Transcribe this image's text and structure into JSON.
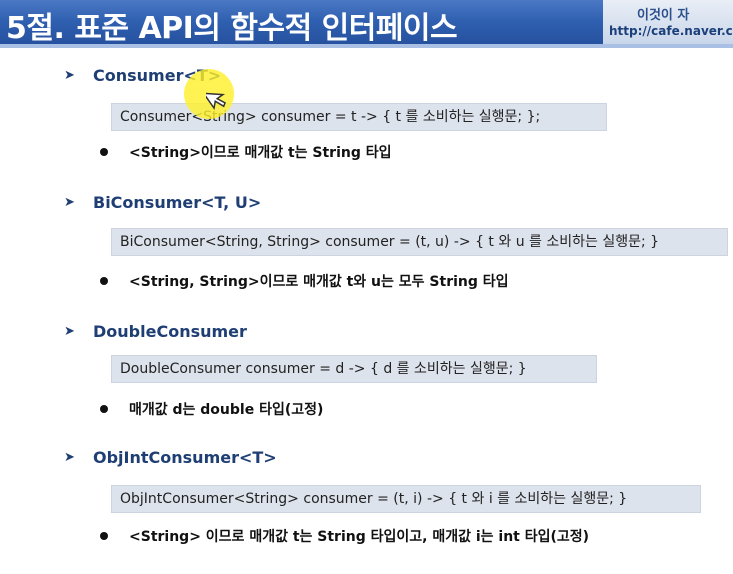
{
  "header": {
    "title": "5절. 표준 API의 함수적 인터페이스",
    "name_text": "이것이 자",
    "url_text": "http://cafe.naver.co"
  },
  "sections": [
    {
      "heading": "Consumer<T>",
      "code": "Consumer<String> consumer = t -> { t 를 소비하는 실행문; };",
      "bullet": "<String>이므로 매개값 t는 String 타입"
    },
    {
      "heading": "BiConsumer<T, U>",
      "code": "BiConsumer<String, String> consumer = (t, u) -> { t 와 u 를 소비하는 실행문; }",
      "bullet": "<String, String>이므로 매개값 t와 u는 모두 String 타입"
    },
    {
      "heading": "DoubleConsumer",
      "code": "DoubleConsumer consumer = d -> { d 를 소비하는 실행문; }",
      "bullet": "매개값 d는 double 타입(고정)"
    },
    {
      "heading": "ObjIntConsumer<T>",
      "code": "ObjIntConsumer<String> consumer = (t, i) -> { t 와 i 를 소비하는 실행문; }",
      "bullet": "<String> 이므로 매개값 t는 String 타입이고, 매개값 i는 int 타입(고정)"
    }
  ],
  "icons": {
    "section_marker": "arrow-marker-icon",
    "bullet_marker": "bullet-dot-icon",
    "cursor": "mouse-cursor-icon"
  },
  "colors": {
    "header_blue": "#2f5fb0",
    "heading_text": "#1f3f74",
    "code_box_bg": "#dde3ec",
    "cursor_highlight": "#fff028"
  }
}
